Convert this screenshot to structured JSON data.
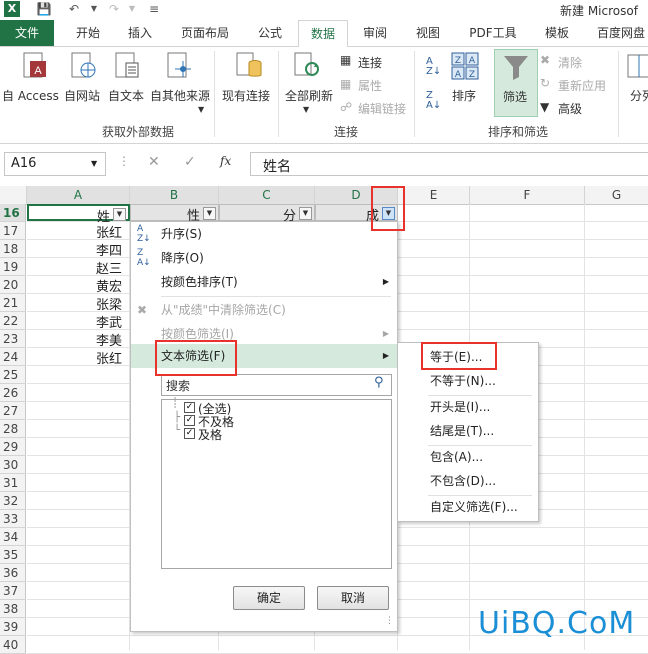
{
  "window": {
    "title": "新建 Microsof"
  },
  "tabs": [
    "文件",
    "开始",
    "插入",
    "页面布局",
    "公式",
    "数据",
    "审阅",
    "视图",
    "PDF工具",
    "模板",
    "百度网盘"
  ],
  "ribbon": {
    "get_external": {
      "access": "自 Access",
      "web": "自网站",
      "text": "自文本",
      "other": "自其他来源",
      "existing": "现有连接",
      "group": "获取外部数据"
    },
    "connections": {
      "refresh": "全部刷新",
      "connections": "连接",
      "properties": "属性",
      "edit_links": "编辑链接",
      "group": "连接"
    },
    "sort_filter": {
      "sort": "排序",
      "filter": "筛选",
      "clear": "清除",
      "reapply": "重新应用",
      "advanced": "高级",
      "group": "排序和筛选"
    },
    "outline": {
      "partial": "分列"
    }
  },
  "formula_bar": {
    "name_box": "A16",
    "value": "姓名"
  },
  "columns": [
    "A",
    "B",
    "C",
    "D",
    "E",
    "F",
    "G"
  ],
  "rows": [
    "16",
    "17",
    "18",
    "19",
    "20",
    "21",
    "22",
    "23",
    "24",
    "25",
    "26",
    "27",
    "28",
    "29",
    "30",
    "31",
    "32",
    "33",
    "34",
    "35",
    "36",
    "37",
    "38",
    "39",
    "40"
  ],
  "header_row": {
    "a": "姓",
    "b": "性",
    "c": "分",
    "d": "成"
  },
  "names": [
    "张红",
    "李四",
    "赵三",
    "黄宏",
    "张梁",
    "李武",
    "李美",
    "张红"
  ],
  "menu": {
    "sort_asc": "升序(S)",
    "sort_desc": "降序(O)",
    "sort_color": "按颜色排序(T)",
    "clear_filter": "从\"成绩\"中清除筛选(C)",
    "filter_color": "按颜色筛选(I)",
    "text_filter": "文本筛选(F)",
    "search_placeholder": "搜索",
    "items": [
      "(全选)",
      "不及格",
      "及格"
    ],
    "ok": "确定",
    "cancel": "取消"
  },
  "submenu": [
    "等于(E)...",
    "不等于(N)...",
    "开头是(I)...",
    "结尾是(T)...",
    "包含(A)...",
    "不包含(D)...",
    "自定义筛选(F)..."
  ],
  "watermark": "UiBQ.CoM",
  "colors": {
    "accent": "#217346",
    "highlight": "#e8332d"
  }
}
